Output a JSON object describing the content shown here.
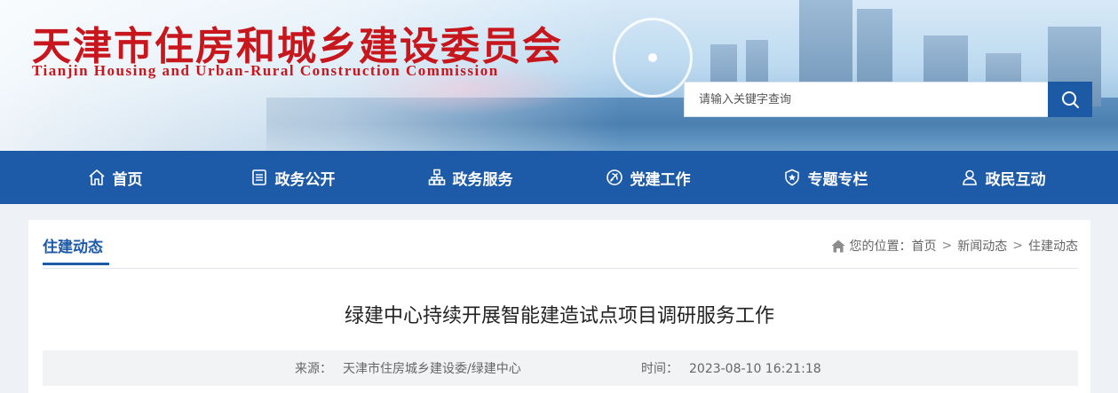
{
  "header": {
    "title_cn": "天津市住房和城乡建设委员会",
    "title_en": "Tianjin Housing and Urban-Rural Construction Commission"
  },
  "search": {
    "placeholder": "请输入关键字查询"
  },
  "nav": {
    "items": [
      {
        "label": "首页",
        "icon": "home-icon"
      },
      {
        "label": "政务公开",
        "icon": "document-icon"
      },
      {
        "label": "政务服务",
        "icon": "org-chart-icon"
      },
      {
        "label": "党建工作",
        "icon": "party-emblem-icon"
      },
      {
        "label": "专题专栏",
        "icon": "badge-star-icon"
      },
      {
        "label": "政民互动",
        "icon": "user-icon"
      }
    ]
  },
  "section": {
    "title": "住建动态",
    "breadcrumb": {
      "prefix": "您的位置：",
      "items": [
        "首页",
        "新闻动态",
        "住建动态"
      ],
      "separator": ">"
    }
  },
  "article": {
    "title": "绿建中心持续开展智能建造试点项目调研服务工作",
    "source_label": "来源：",
    "source_value": "天津市住房城乡建设委/绿建中心",
    "time_label": "时间：",
    "time_value": "2023-08-10 16:21:18"
  },
  "colors": {
    "brand_blue": "#1d5aa7",
    "title_red": "#c8161d"
  }
}
